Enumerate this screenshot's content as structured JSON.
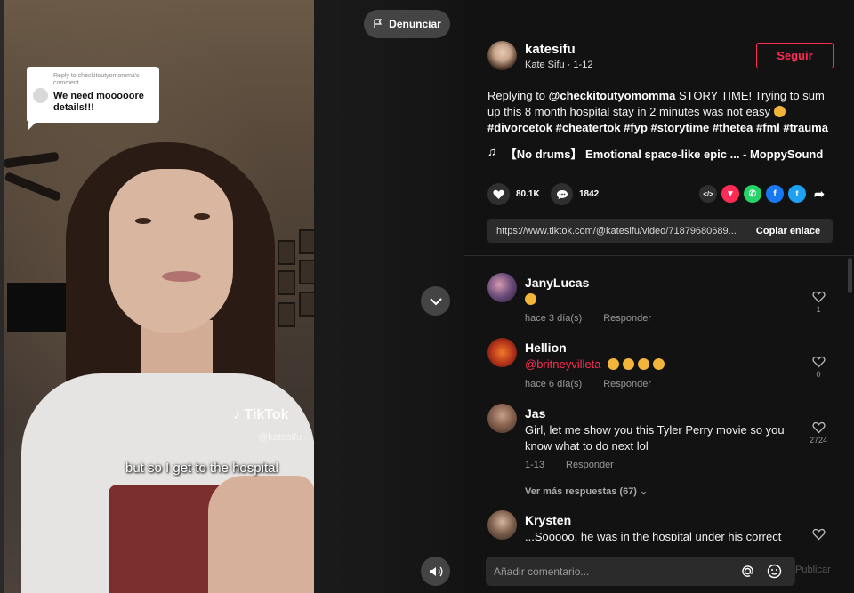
{
  "video": {
    "reply_meta": "Reply to checkitoutyomomma's comment",
    "reply_text": "We need mooooore details!!!",
    "watermark": "TikTok",
    "watermark_user": "@katesifu",
    "subtitle": "but so I get to the hospital",
    "report_label": "Denunciar"
  },
  "post": {
    "username": "katesifu",
    "display_sub": "Kate Sifu · 1-12",
    "follow_label": "Seguir",
    "desc_prefix": "Replying to",
    "desc_mention": "@checkitoutyomomma",
    "desc_body": "STORY TIME! Trying to sum up this 8 month hospital stay in 2 minutes was not easy",
    "hashtags": "#divorcetok #cheatertok #fyp #storytime #thetea #fml #trauma",
    "music": "【No drums】 Emotional space-like epic ... - MoppySound",
    "likes": "80.1K",
    "comments_count": "1842",
    "link_url": "https://www.tiktok.com/@katesifu/video/71879680689...",
    "copy_label": "Copiar enlace"
  },
  "comments": [
    {
      "name": "JanyLucas",
      "text": "",
      "meta_time": "hace 3 día(s)",
      "reply_label": "Responder",
      "likes": "1"
    },
    {
      "name": "Hellion",
      "mention": "@britneyvilleta",
      "meta_time": "hace 6 día(s)",
      "reply_label": "Responder",
      "likes": "0"
    },
    {
      "name": "Jas",
      "text": "Girl, let me show you this Tyler Perry movie so you know what to do next lol",
      "meta_time": "1-13",
      "reply_label": "Responder",
      "likes": "2724"
    },
    {
      "name": "Krysten",
      "text": "...Sooooo, he was in the hospital under his correct"
    }
  ],
  "more_replies": "Ver más respuestas (67)",
  "input": {
    "placeholder": "Añadir comentario...",
    "post_label": "Publicar"
  },
  "colors": {
    "accent": "#fe2c55",
    "panel_bg": "#121212"
  }
}
